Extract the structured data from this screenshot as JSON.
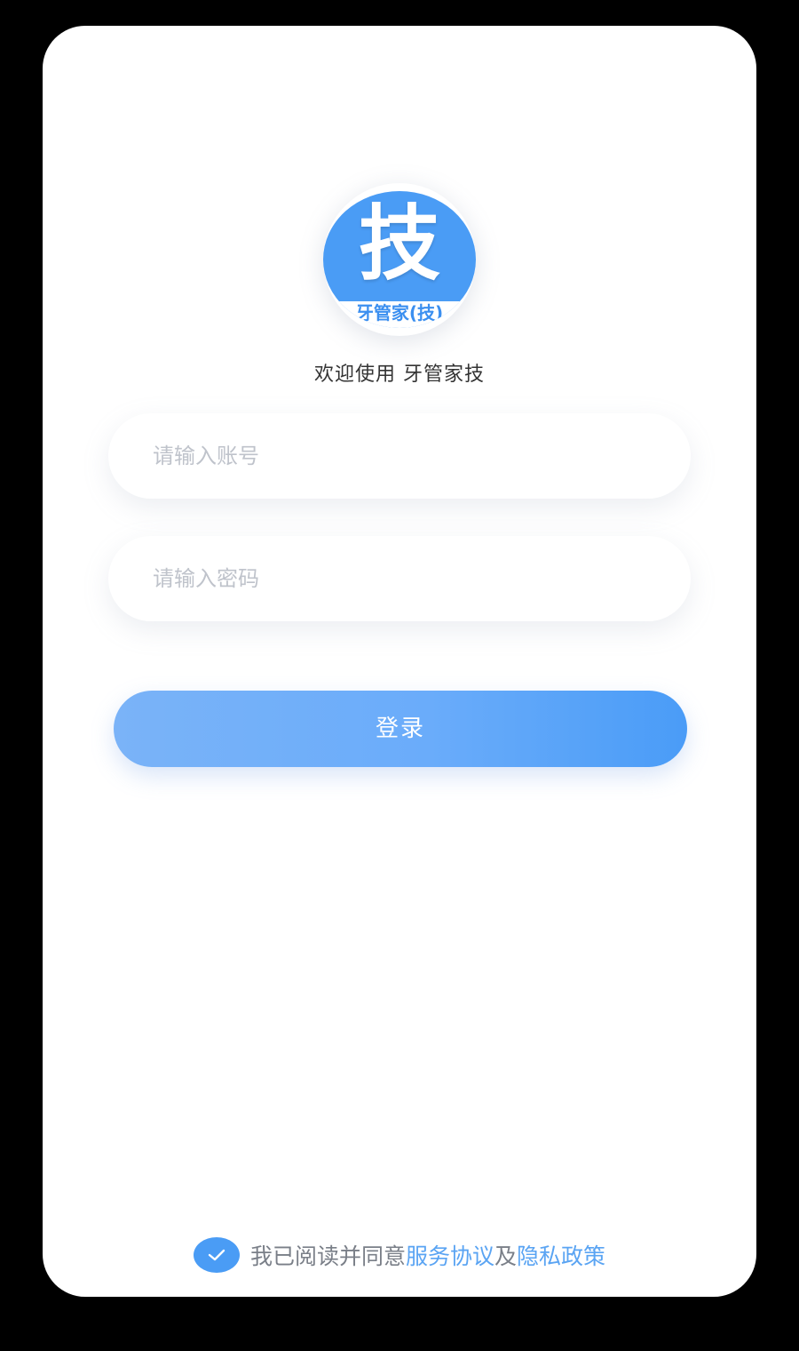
{
  "app": {
    "logo_char": "技",
    "logo_band": "牙管家(技)",
    "welcome": "欢迎使用 牙管家技"
  },
  "login": {
    "account_placeholder": "请输入账号",
    "password_placeholder": "请输入密码",
    "button_label": "登录"
  },
  "agreement": {
    "checked": true,
    "prefix": "我已阅读并同意",
    "service_link": "服务协议",
    "conjunction": "及",
    "privacy_link": "隐私政策"
  },
  "colors": {
    "accent": "#4a9cf5",
    "link": "#5aa4f3",
    "background": "#000000",
    "screen": "#ffffff"
  },
  "icons": {
    "check": "check-icon"
  }
}
